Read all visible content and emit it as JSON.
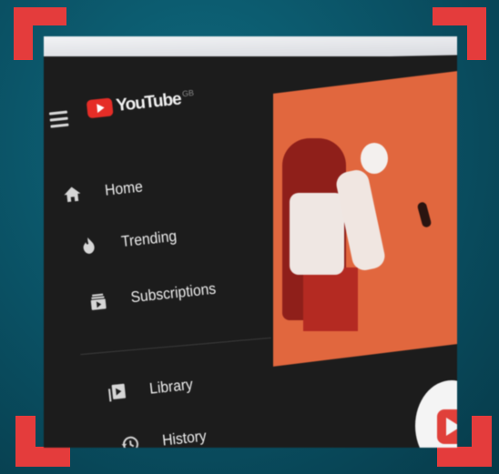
{
  "app": {
    "logo_text": "YouTube",
    "logo_superscript": "GB"
  },
  "sidebar": {
    "items": [
      {
        "label": "Home",
        "icon": "home-icon"
      },
      {
        "label": "Trending",
        "icon": "flame-icon"
      },
      {
        "label": "Subscriptions",
        "icon": "subscriptions-icon"
      },
      {
        "label": "Library",
        "icon": "library-icon"
      },
      {
        "label": "History",
        "icon": "history-icon"
      }
    ]
  },
  "colors": {
    "frame_corner": "#e43c3c",
    "background": "#0a5063",
    "youtube_red": "#e52d27",
    "thumbnail_orange": "#e1673e",
    "screen_dark": "#1c1c1c"
  }
}
